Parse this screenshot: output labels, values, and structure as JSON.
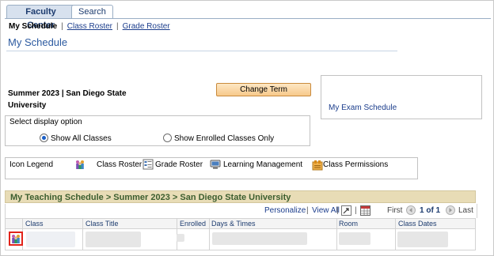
{
  "tabs": [
    {
      "label": "Faculty Center",
      "active": true
    },
    {
      "label": "Search",
      "active": false
    }
  ],
  "subnav": {
    "my_schedule": "My Schedule",
    "class_roster": "Class Roster",
    "grade_roster": "Grade Roster",
    "separator": "|"
  },
  "page_title": "My Schedule",
  "term": {
    "line1": "Summer 2023 | San Diego State",
    "line2": "University"
  },
  "change_term_button": "Change Term",
  "exam_schedule_link": "My Exam Schedule",
  "display_option": {
    "label": "Select display option",
    "options": [
      {
        "label": "Show All Classes",
        "selected": true
      },
      {
        "label": "Show Enrolled Classes Only",
        "selected": false
      }
    ]
  },
  "icon_legend": {
    "title": "Icon Legend",
    "items": [
      {
        "icon": "class-roster-icon",
        "label": "Class Roster"
      },
      {
        "icon": "grade-roster-icon",
        "label": "Grade Roster"
      },
      {
        "icon": "learning-management-icon",
        "label": "Learning Management"
      },
      {
        "icon": "class-permissions-icon",
        "label": "Class Permissions"
      }
    ]
  },
  "teaching_schedule": {
    "title": "My Teaching Schedule > Summer 2023 > San Diego State University",
    "navbar": {
      "personalize": "Personalize",
      "view_all": "View All",
      "first": "First",
      "page_info": "1 of 1",
      "last": "Last",
      "separator": "|"
    },
    "columns": [
      "Class",
      "Class Title",
      "Enrolled",
      "Days & Times",
      "Room",
      "Class Dates"
    ]
  },
  "colors": {
    "tab_active_bg": "#d7e1ee",
    "link": "#1b3d8c",
    "title": "#2c5aa0",
    "grid_header_bg": "#e8dcb6",
    "grid_header_text": "#3c5e2f",
    "highlight": "#e2231a"
  }
}
